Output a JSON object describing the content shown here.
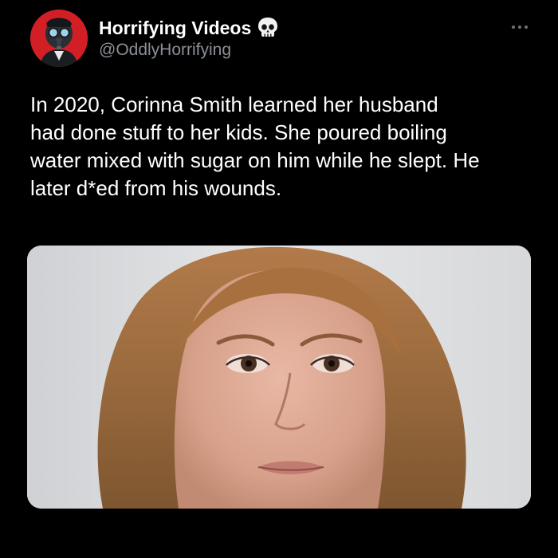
{
  "author": {
    "display_name": "Horrifying Videos",
    "handle": "@OddlyHorrifying",
    "avatar_icon": "plague-mask-avatar",
    "badge_icon": "skull-icon"
  },
  "menu": {
    "icon": "more-options-icon"
  },
  "post": {
    "text": "In 2020, Corinna Smith learned her husband\nhad done stuff to her kids. She poured boiling\nwater mixed with sugar on him while he slept. He\nlater d*ed from his wounds."
  },
  "media": {
    "kind": "photo"
  },
  "colors": {
    "background": "#000000",
    "text": "#ffffff",
    "secondary_text": "#8b9096",
    "avatar_bg": "#d21f26"
  }
}
